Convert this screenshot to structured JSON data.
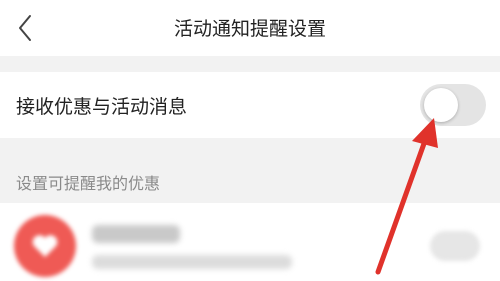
{
  "header": {
    "title": "活动通知提醒设置",
    "back_icon": "chevron-left-icon"
  },
  "settings": {
    "promo_label": "接收优惠与活动消息",
    "promo_toggle_on": false
  },
  "reminders": {
    "section_title": "设置可提醒我的优惠"
  },
  "colors": {
    "arrow": "#e0322b",
    "brand_logo": "#ef5a55"
  }
}
